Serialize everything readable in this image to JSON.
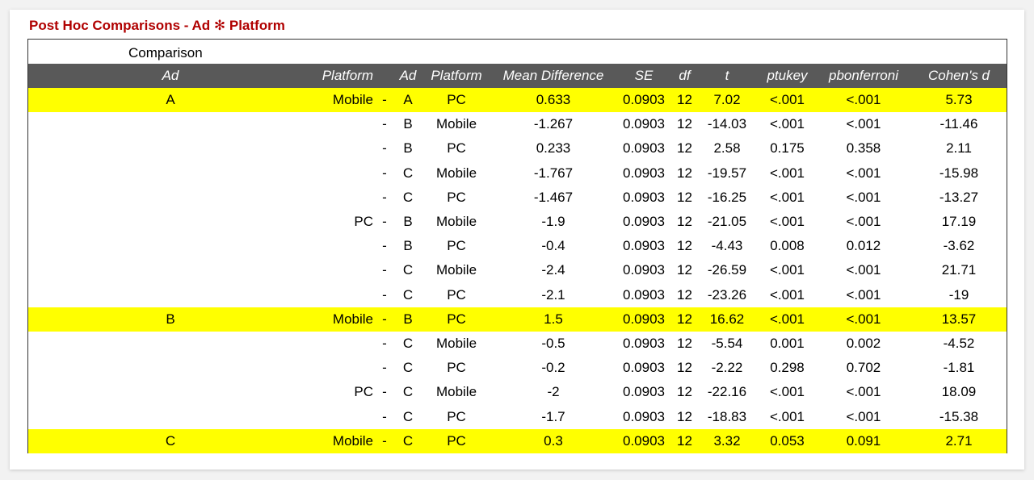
{
  "title": "Post Hoc Comparisons - Ad ✻ Platform",
  "comparison_label": "Comparison",
  "columns": [
    "Ad",
    "Platform",
    "",
    "Ad",
    "Platform",
    "Mean Difference",
    "SE",
    "df",
    "t",
    "ptukey",
    "pbonferroni",
    "Cohen's d"
  ],
  "highlight_color": "#ffff00",
  "header_bg": "#595959",
  "rows": [
    {
      "ad1": "A",
      "plat1": "Mobile",
      "dash": "-",
      "ad2": "A",
      "plat2": "PC",
      "md": "0.633",
      "se": "0.0903",
      "df": "12",
      "t": "7.02",
      "ptukey": "<.001",
      "pbonf": "<.001",
      "d": "5.73",
      "highlight": true
    },
    {
      "ad1": "",
      "plat1": "",
      "dash": "-",
      "ad2": "B",
      "plat2": "Mobile",
      "md": "-1.267",
      "se": "0.0903",
      "df": "12",
      "t": "-14.03",
      "ptukey": "<.001",
      "pbonf": "<.001",
      "d": "-11.46",
      "highlight": false
    },
    {
      "ad1": "",
      "plat1": "",
      "dash": "-",
      "ad2": "B",
      "plat2": "PC",
      "md": "0.233",
      "se": "0.0903",
      "df": "12",
      "t": "2.58",
      "ptukey": "0.175",
      "pbonf": "0.358",
      "d": "2.11",
      "highlight": false
    },
    {
      "ad1": "",
      "plat1": "",
      "dash": "-",
      "ad2": "C",
      "plat2": "Mobile",
      "md": "-1.767",
      "se": "0.0903",
      "df": "12",
      "t": "-19.57",
      "ptukey": "<.001",
      "pbonf": "<.001",
      "d": "-15.98",
      "highlight": false
    },
    {
      "ad1": "",
      "plat1": "",
      "dash": "-",
      "ad2": "C",
      "plat2": "PC",
      "md": "-1.467",
      "se": "0.0903",
      "df": "12",
      "t": "-16.25",
      "ptukey": "<.001",
      "pbonf": "<.001",
      "d": "-13.27",
      "highlight": false
    },
    {
      "ad1": "",
      "plat1": "PC",
      "dash": "-",
      "ad2": "B",
      "plat2": "Mobile",
      "md": "-1.9",
      "se": "0.0903",
      "df": "12",
      "t": "-21.05",
      "ptukey": "<.001",
      "pbonf": "<.001",
      "d": "17.19",
      "highlight": false
    },
    {
      "ad1": "",
      "plat1": "",
      "dash": "-",
      "ad2": "B",
      "plat2": "PC",
      "md": "-0.4",
      "se": "0.0903",
      "df": "12",
      "t": "-4.43",
      "ptukey": "0.008",
      "pbonf": "0.012",
      "d": "-3.62",
      "highlight": false
    },
    {
      "ad1": "",
      "plat1": "",
      "dash": "-",
      "ad2": "C",
      "plat2": "Mobile",
      "md": "-2.4",
      "se": "0.0903",
      "df": "12",
      "t": "-26.59",
      "ptukey": "<.001",
      "pbonf": "<.001",
      "d": "21.71",
      "highlight": false
    },
    {
      "ad1": "",
      "plat1": "",
      "dash": "-",
      "ad2": "C",
      "plat2": "PC",
      "md": "-2.1",
      "se": "0.0903",
      "df": "12",
      "t": "-23.26",
      "ptukey": "<.001",
      "pbonf": "<.001",
      "d": "-19",
      "highlight": false
    },
    {
      "ad1": "B",
      "plat1": "Mobile",
      "dash": "-",
      "ad2": "B",
      "plat2": "PC",
      "md": "1.5",
      "se": "0.0903",
      "df": "12",
      "t": "16.62",
      "ptukey": "<.001",
      "pbonf": "<.001",
      "d": "13.57",
      "highlight": true
    },
    {
      "ad1": "",
      "plat1": "",
      "dash": "-",
      "ad2": "C",
      "plat2": "Mobile",
      "md": "-0.5",
      "se": "0.0903",
      "df": "12",
      "t": "-5.54",
      "ptukey": "0.001",
      "pbonf": "0.002",
      "d": "-4.52",
      "highlight": false
    },
    {
      "ad1": "",
      "plat1": "",
      "dash": "-",
      "ad2": "C",
      "plat2": "PC",
      "md": "-0.2",
      "se": "0.0903",
      "df": "12",
      "t": "-2.22",
      "ptukey": "0.298",
      "pbonf": "0.702",
      "d": "-1.81",
      "highlight": false
    },
    {
      "ad1": "",
      "plat1": "PC",
      "dash": "-",
      "ad2": "C",
      "plat2": "Mobile",
      "md": "-2",
      "se": "0.0903",
      "df": "12",
      "t": "-22.16",
      "ptukey": "<.001",
      "pbonf": "<.001",
      "d": "18.09",
      "highlight": false
    },
    {
      "ad1": "",
      "plat1": "",
      "dash": "-",
      "ad2": "C",
      "plat2": "PC",
      "md": "-1.7",
      "se": "0.0903",
      "df": "12",
      "t": "-18.83",
      "ptukey": "<.001",
      "pbonf": "<.001",
      "d": "-15.38",
      "highlight": false
    },
    {
      "ad1": "C",
      "plat1": "Mobile",
      "dash": "-",
      "ad2": "C",
      "plat2": "PC",
      "md": "0.3",
      "se": "0.0903",
      "df": "12",
      "t": "3.32",
      "ptukey": "0.053",
      "pbonf": "0.091",
      "d": "2.71",
      "highlight": true
    }
  ]
}
